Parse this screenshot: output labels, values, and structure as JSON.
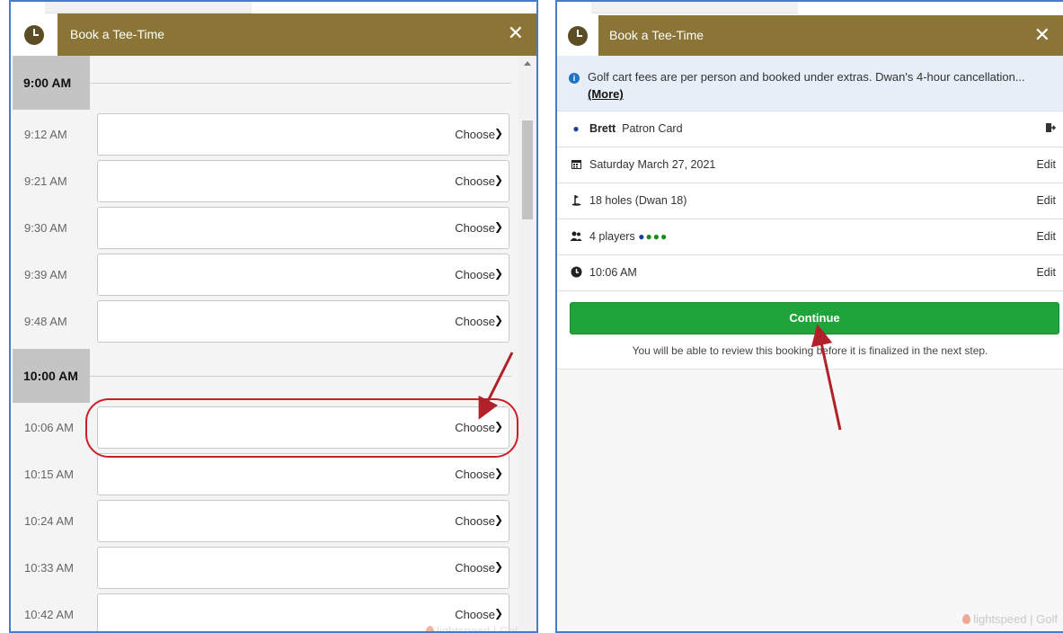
{
  "left_panel": {
    "header": {
      "title": "Book a Tee-Time",
      "close_glyph": "✕"
    },
    "hour_blocks": [
      {
        "hour": "9:00 AM",
        "slots": [
          {
            "time": "9:12 AM",
            "choose": "Choose"
          },
          {
            "time": "9:21 AM",
            "choose": "Choose"
          },
          {
            "time": "9:30 AM",
            "choose": "Choose"
          },
          {
            "time": "9:39 AM",
            "choose": "Choose"
          },
          {
            "time": "9:48 AM",
            "choose": "Choose"
          }
        ]
      },
      {
        "hour": "10:00 AM",
        "slots": [
          {
            "time": "10:06 AM",
            "choose": "Choose"
          },
          {
            "time": "10:15 AM",
            "choose": "Choose"
          },
          {
            "time": "10:24 AM",
            "choose": "Choose"
          },
          {
            "time": "10:33 AM",
            "choose": "Choose"
          },
          {
            "time": "10:42 AM",
            "choose": "Choose"
          }
        ]
      }
    ],
    "watermark": "lightspeed | Golf",
    "highlighted_slot": "10:06 AM"
  },
  "right_panel": {
    "header": {
      "title": "Book a Tee-Time",
      "close_glyph": "✕"
    },
    "info": {
      "text": "Golf cart fees are per person and booked under extras. Dwan's 4-hour cancellation...",
      "more_label": "(More)"
    },
    "player": {
      "name": "Brett",
      "card": "Patron Card"
    },
    "date": {
      "value": "Saturday March 27, 2021",
      "edit": "Edit"
    },
    "course": {
      "value": "18 holes (Dwan 18)",
      "edit": "Edit"
    },
    "players": {
      "value": "4 players",
      "edit": "Edit"
    },
    "time": {
      "value": "10:06 AM",
      "edit": "Edit"
    },
    "continue_label": "Continue",
    "note": "You will be able to review this booking before it is finalized in the next step.",
    "watermark": "lightspeed | Golf"
  },
  "icons": {
    "header": "clock-icon",
    "info": "info-icon",
    "player": "bullet-icon",
    "card_action": "sign-out-icon",
    "date": "calendar-icon",
    "course": "golf-flag-icon",
    "players": "users-icon",
    "time": "clock-icon"
  },
  "colors": {
    "header_bg": "#8a7436",
    "continue_bg": "#1fa43b",
    "annotation_red": "#c8202b",
    "panel_border": "#4a7bc4"
  }
}
